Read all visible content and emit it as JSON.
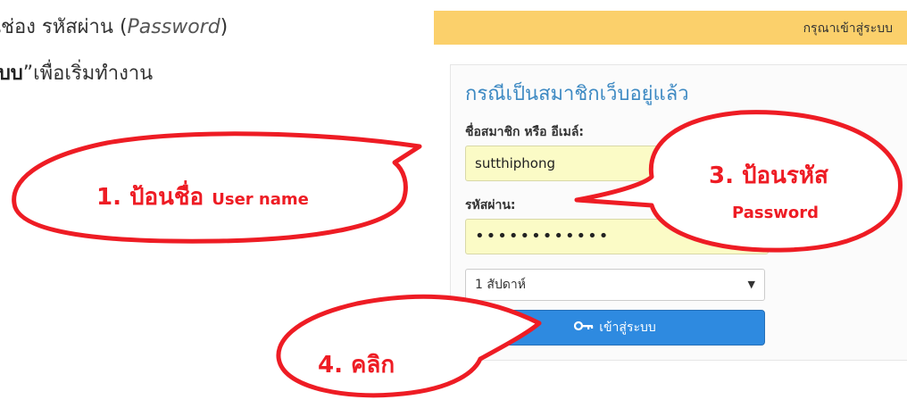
{
  "instructions": {
    "line1_thai": "นช่อง รหัสผ่าน (",
    "line1_en": "Password",
    "line1_close": ")",
    "line2_bold": "ะบบ",
    "line2_rest": "”เพื่อเริ่มทำงาน"
  },
  "top_bar": {
    "text": "กรุณาเข้าสู่ระบบ",
    "color": "#fbd06b"
  },
  "login_panel": {
    "heading": "กรณีเป็นสมาชิกเว็บอยู่แล้ว",
    "username_label": "ชื่อสมาชิก หรือ อีเมล์:",
    "username_value": "sutthiphong",
    "password_label": "รหัสผ่าน:",
    "password_value": "••••••••••••",
    "remember_select": "1 สัปดาห์",
    "login_button": "เข้าสู่ระบบ",
    "accent": "#2e8ae0",
    "heading_color": "#3e8ac3",
    "input_bg": "#fbfbc6"
  },
  "callouts": {
    "c1_main": "1. ป้อนชื่อ",
    "c1_sub": "User name",
    "c3_main": "3. ป้อนรหัส",
    "c3_sub": "Password",
    "c4_main": "4. คลิก",
    "color": "#ee1c24"
  }
}
